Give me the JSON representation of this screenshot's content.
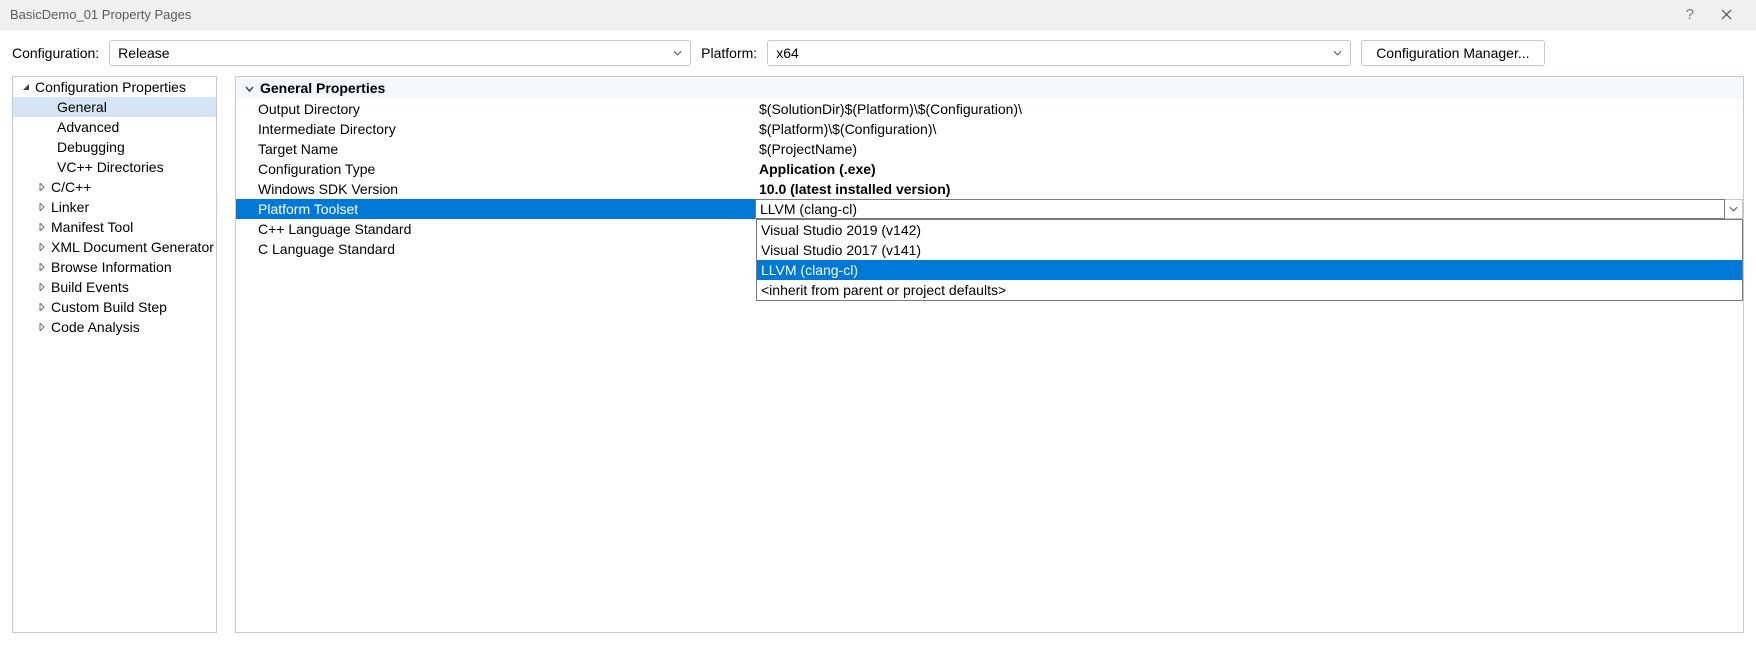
{
  "titlebar": {
    "title": "BasicDemo_01 Property Pages"
  },
  "configbar": {
    "config_label": "Configuration:",
    "config_value": "Release",
    "platform_label": "Platform:",
    "platform_value": "x64",
    "manager_button": "Configuration Manager..."
  },
  "tree": {
    "root": "Configuration Properties",
    "items": [
      {
        "label": "General",
        "expandable": false,
        "selected": true
      },
      {
        "label": "Advanced",
        "expandable": false
      },
      {
        "label": "Debugging",
        "expandable": false
      },
      {
        "label": "VC++ Directories",
        "expandable": false
      },
      {
        "label": "C/C++",
        "expandable": true
      },
      {
        "label": "Linker",
        "expandable": true
      },
      {
        "label": "Manifest Tool",
        "expandable": true
      },
      {
        "label": "XML Document Generator",
        "expandable": true
      },
      {
        "label": "Browse Information",
        "expandable": true
      },
      {
        "label": "Build Events",
        "expandable": true
      },
      {
        "label": "Custom Build Step",
        "expandable": true
      },
      {
        "label": "Code Analysis",
        "expandable": true
      }
    ]
  },
  "props": {
    "header": "General Properties",
    "rows": [
      {
        "name": "Output Directory",
        "value": "$(SolutionDir)$(Platform)\\$(Configuration)\\",
        "bold": false
      },
      {
        "name": "Intermediate Directory",
        "value": "$(Platform)\\$(Configuration)\\",
        "bold": false
      },
      {
        "name": "Target Name",
        "value": "$(ProjectName)",
        "bold": false
      },
      {
        "name": "Configuration Type",
        "value": "Application (.exe)",
        "bold": true
      },
      {
        "name": "Windows SDK Version",
        "value": "10.0 (latest installed version)",
        "bold": true
      },
      {
        "name": "Platform Toolset",
        "value": "LLVM (clang-cl)",
        "bold": true,
        "selected": true
      },
      {
        "name": "C++ Language Standard",
        "value": "",
        "bold": false
      },
      {
        "name": "C Language Standard",
        "value": "",
        "bold": false
      }
    ]
  },
  "dropdown": {
    "options": [
      {
        "label": "Visual Studio 2019 (v142)"
      },
      {
        "label": "Visual Studio 2017 (v141)"
      },
      {
        "label": "LLVM (clang-cl)",
        "highlight": true
      },
      {
        "label": "<inherit from parent or project defaults>"
      }
    ]
  }
}
